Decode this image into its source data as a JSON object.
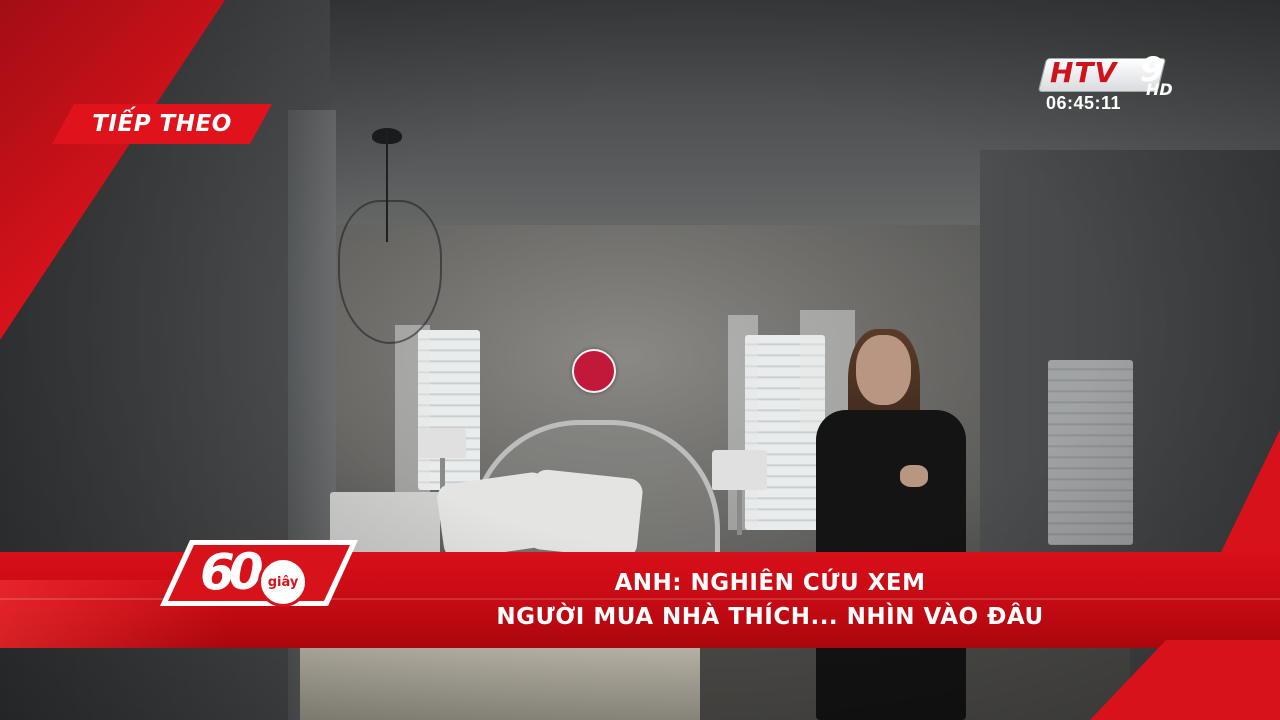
{
  "overlay": {
    "next_label": "TIẾP THEO",
    "channel": {
      "name": "HTV",
      "number": "9",
      "quality": "HD",
      "clock": "06:45:11"
    },
    "program_logo": {
      "digits": "60",
      "word": "giây"
    },
    "headline": {
      "line1": "ANH: NGHIÊN CỨU XEM",
      "line2": "NGƯỜI MUA NHÀ THÍCH... NHÌN VÀO ĐÂU"
    }
  },
  "colors": {
    "accent_red": "#d8121b",
    "marker": "#c2183a",
    "text": "#ffffff"
  }
}
